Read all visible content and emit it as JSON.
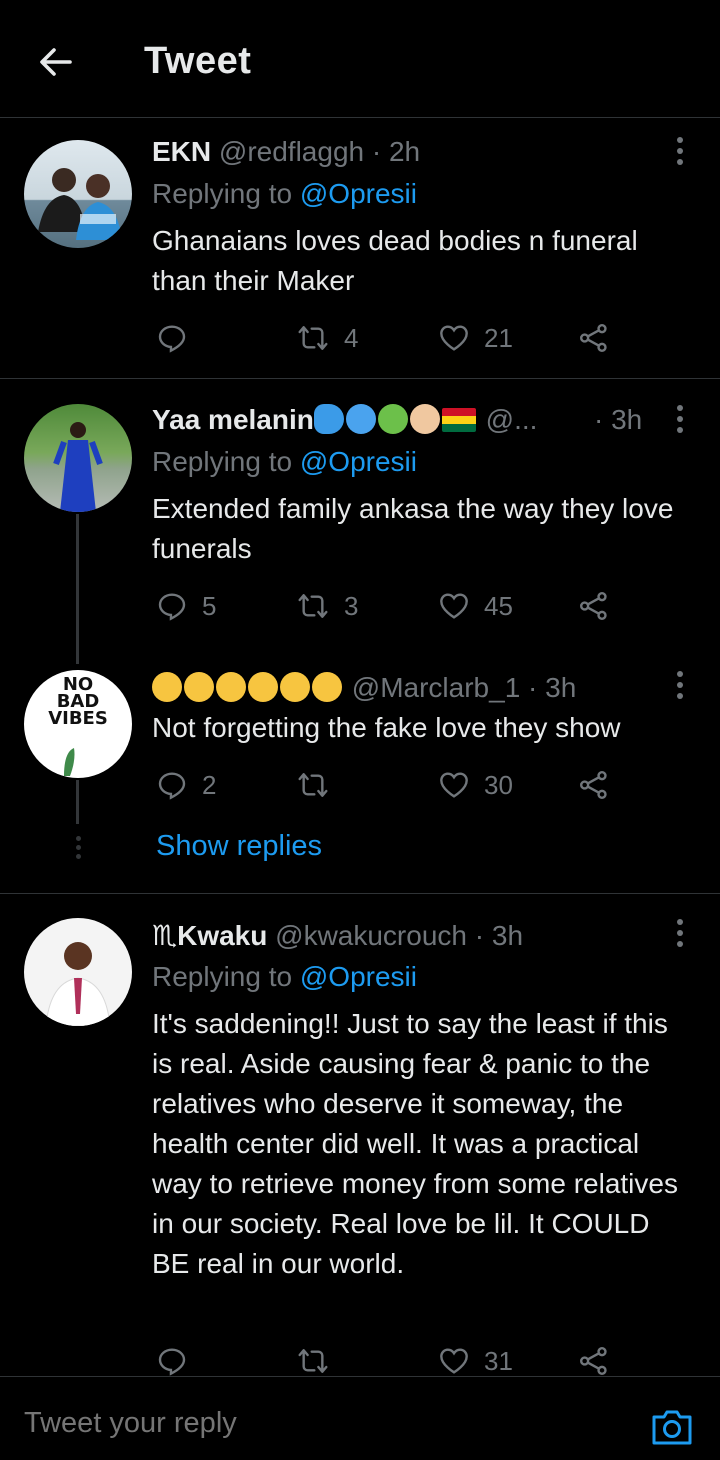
{
  "header": {
    "title": "Tweet"
  },
  "tweets": [
    {
      "name": "EKN",
      "handle": "@redflaggh",
      "time": "· 2h",
      "replying_prefix": "Replying to",
      "replying_to": "@Opresii",
      "text": "Ghanaians loves dead bodies n funeral than their Maker",
      "replies": "",
      "retweets": "4",
      "likes": "21"
    },
    {
      "name": "Yaa melanin",
      "handle": "@...",
      "time": "· 3h",
      "replying_prefix": "Replying to",
      "replying_to": "@Opresii",
      "text": "Extended family ankasa the way they love funerals",
      "replies": "5",
      "retweets": "3",
      "likes": "45"
    },
    {
      "name": "",
      "handle": "@Marclarb_1",
      "time": "· 3h",
      "text": "Not forgetting the fake love they show",
      "avatar_text": "NO BAD VIBES",
      "replies": "2",
      "retweets": "",
      "likes": "30"
    },
    {
      "name": "♏Kwaku",
      "handle": "@kwakucrouch",
      "time": "· 3h",
      "replying_prefix": "Replying to",
      "replying_to": "@Opresii",
      "text": "It's saddening!! Just to say the least if this is real. Aside causing fear & panic to the relatives who deserve it someway, the health center did well. It was a practical way to retrieve money from some relatives in our society. Real love be lil. It COULD BE real in our world.",
      "replies": "",
      "retweets": "",
      "likes": "31"
    }
  ],
  "show_replies": "Show replies",
  "reply_bar": {
    "placeholder": "Tweet your reply"
  },
  "colors": {
    "accent": "#1d9bf0",
    "muted": "#71767b",
    "text": "#e7e9ea",
    "background": "#000000"
  }
}
